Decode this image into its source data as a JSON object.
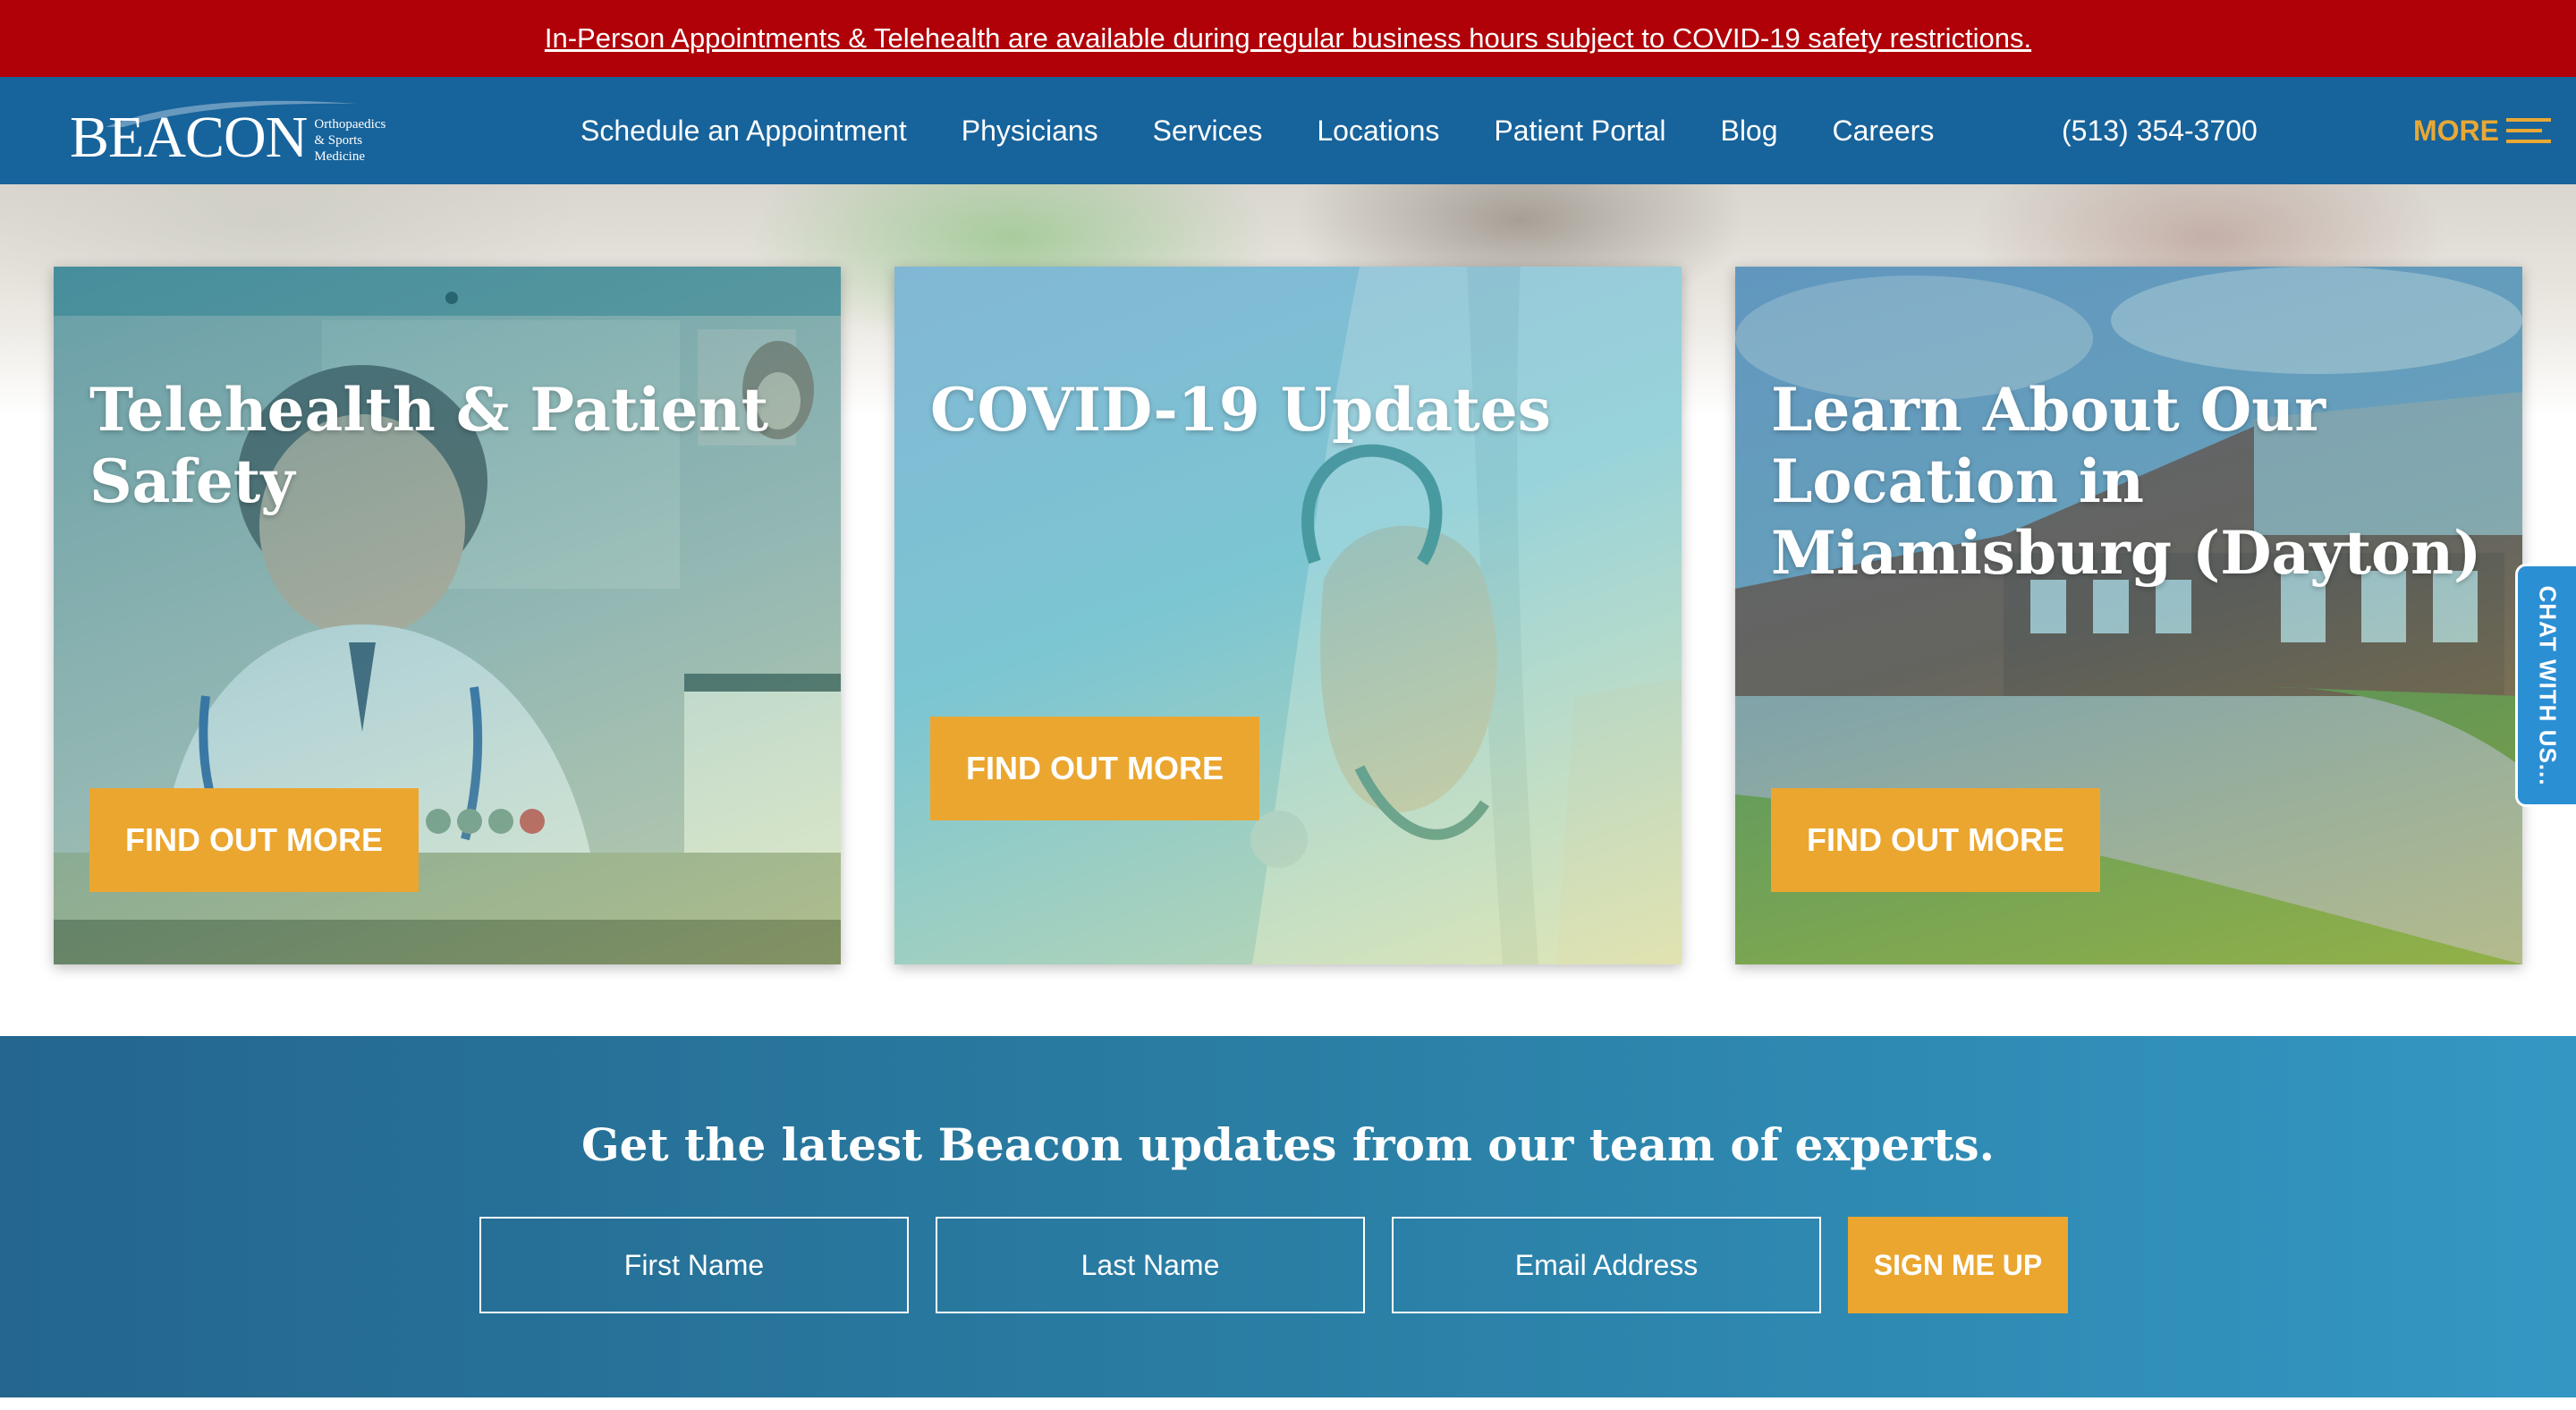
{
  "alert": {
    "text": "In-Person Appointments & Telehealth are available during regular business hours subject to COVID-19 safety restrictions."
  },
  "header": {
    "logo_text": "BEACON",
    "logo_subtitle": "Orthopaedics & Sports Medicine",
    "nav": [
      {
        "label": "Schedule an Appointment"
      },
      {
        "label": "Physicians"
      },
      {
        "label": "Services"
      },
      {
        "label": "Locations"
      },
      {
        "label": "Patient Portal"
      },
      {
        "label": "Blog"
      },
      {
        "label": "Careers"
      }
    ],
    "phone": "(513) 354-3700",
    "more_label": "MORE"
  },
  "cards": [
    {
      "title": "Telehealth & Patient Safety",
      "button": "FIND OUT MORE"
    },
    {
      "title": "COVID-19 Updates",
      "button": "FIND OUT MORE"
    },
    {
      "title": "Learn About Our Location in Miamisburg (Dayton)",
      "button": "FIND OUT MORE"
    }
  ],
  "chat": {
    "label": "CHAT WITH US..."
  },
  "signup": {
    "heading": "Get the latest Beacon updates from our team of experts.",
    "first_name_placeholder": "First Name",
    "last_name_placeholder": "Last Name",
    "email_placeholder": "Email Address",
    "button": "SIGN ME UP"
  },
  "colors": {
    "alert_bg": "#b00008",
    "nav_bg": "#17639b",
    "accent": "#eba62f",
    "chat_bg": "#2b8fd4",
    "signup_bg": "#2a7ea4"
  }
}
